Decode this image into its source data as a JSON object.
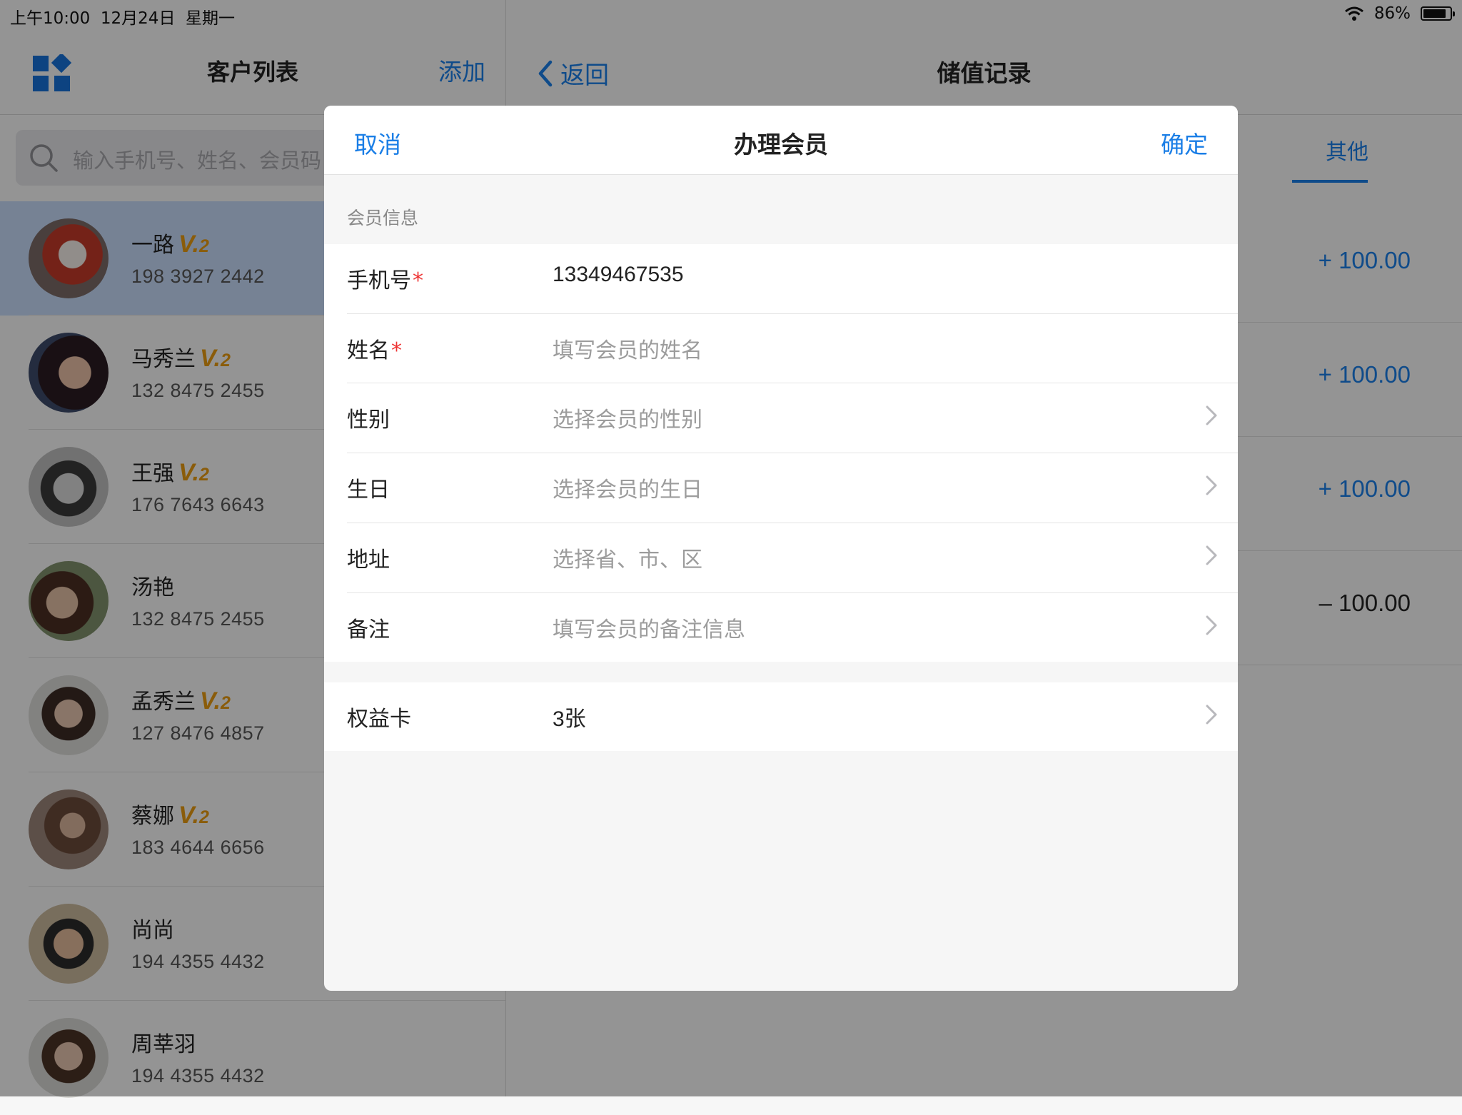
{
  "status_bar": {
    "datetime": "上午10:00  12月24日  星期一",
    "battery": "86%",
    "battery_level": 0.86
  },
  "left": {
    "title": "客户列表",
    "add_label": "添加",
    "search_placeholder": "输入手机号、姓名、会员码",
    "customers": [
      {
        "name": "一路",
        "vip": true,
        "phone": "198 3927 2442",
        "selected": true
      },
      {
        "name": "马秀兰",
        "vip": true,
        "phone": "132 8475 2455"
      },
      {
        "name": "王强",
        "vip": true,
        "phone": "176 7643 6643"
      },
      {
        "name": "汤艳",
        "vip": false,
        "phone": "132 8475 2455"
      },
      {
        "name": "孟秀兰",
        "vip": true,
        "phone": "127 8476 4857"
      },
      {
        "name": "蔡娜",
        "vip": true,
        "phone": "183 4644 6656"
      },
      {
        "name": "尚尚",
        "vip": false,
        "phone": "194 4355 4432"
      },
      {
        "name": "周莘羽",
        "vip": false,
        "phone": "194 4355 4432"
      }
    ],
    "vip_prefix": "V.",
    "vip_level": "2"
  },
  "right": {
    "back_label": "返回",
    "title": "储值记录",
    "tab_label": "其他",
    "records": [
      "+ 100.00",
      "+ 100.00",
      "+ 100.00",
      "– 100.00"
    ]
  },
  "modal": {
    "cancel_label": "取消",
    "title": "办理会员",
    "confirm_label": "确定",
    "section_title": "会员信息",
    "fields": {
      "phone": {
        "label": "手机号",
        "value": "13349467535"
      },
      "name": {
        "label": "姓名",
        "placeholder": "填写会员的姓名"
      },
      "gender": {
        "label": "性别",
        "placeholder": "选择会员的性别"
      },
      "birthday": {
        "label": "生日",
        "placeholder": "选择会员的生日"
      },
      "address": {
        "label": "地址",
        "placeholder": "选择省、市、区"
      },
      "notes": {
        "label": "备注",
        "placeholder": "填写会员的备注信息"
      },
      "benefit_card": {
        "label": "权益卡",
        "value": "3张"
      }
    },
    "required_mark": "*"
  }
}
